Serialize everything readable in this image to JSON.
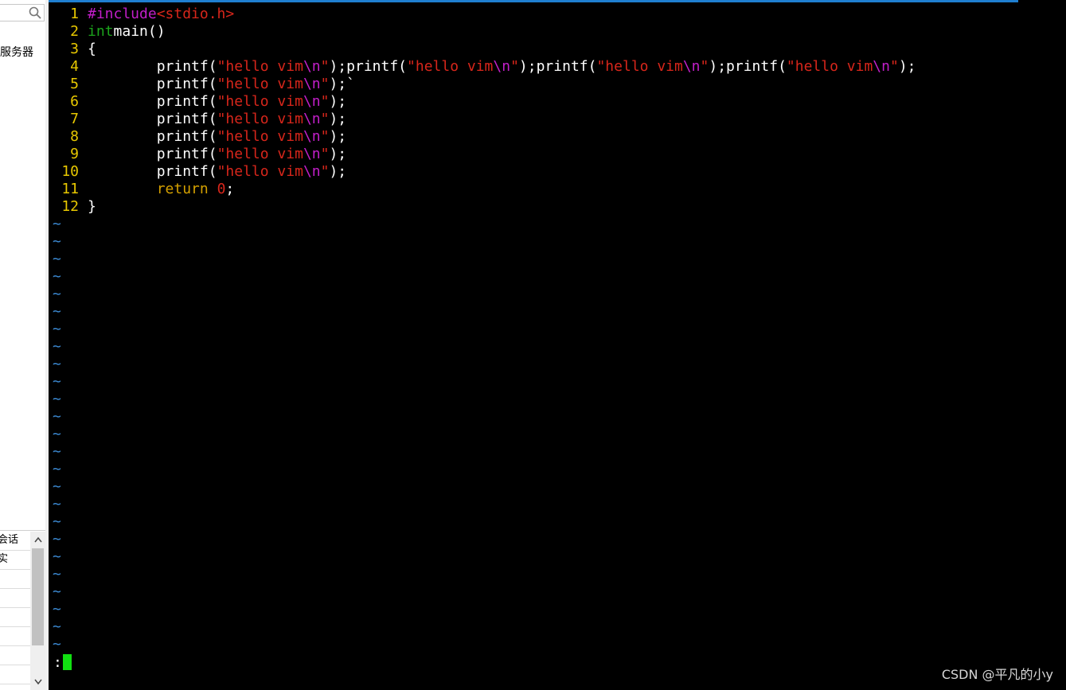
{
  "sidebar": {
    "label": "服务器",
    "list_items": [
      "会话",
      "实",
      "",
      "",
      "",
      "",
      "",
      ""
    ],
    "scroll_up": "^",
    "scroll_down": "v"
  },
  "editor": {
    "lines": [
      {
        "n": "1",
        "tokens": [
          [
            "pp",
            "#include"
          ],
          [
            "str",
            "<stdio.h>"
          ]
        ]
      },
      {
        "n": "2",
        "tokens": [
          [
            "kwg",
            "int"
          ],
          [
            "",
            "main()"
          ]
        ]
      },
      {
        "n": "3",
        "tokens": [
          [
            "",
            "{"
          ]
        ]
      },
      {
        "n": "4",
        "tokens": [
          [
            "",
            "        printf("
          ],
          [
            "str",
            "\"hello vim"
          ],
          [
            "esc",
            "\\n"
          ],
          [
            "str",
            "\""
          ],
          [
            "",
            ");printf("
          ],
          [
            "str",
            "\"hello vim"
          ],
          [
            "esc",
            "\\n"
          ],
          [
            "str",
            "\""
          ],
          [
            "",
            ");printf("
          ],
          [
            "str",
            "\"hello vim"
          ],
          [
            "esc",
            "\\n"
          ],
          [
            "str",
            "\""
          ],
          [
            "",
            ");printf("
          ],
          [
            "str",
            "\"hello vim"
          ],
          [
            "esc",
            "\\n"
          ],
          [
            "str",
            "\""
          ],
          [
            "",
            ");"
          ]
        ]
      },
      {
        "n": "5",
        "tokens": [
          [
            "",
            "        printf("
          ],
          [
            "str",
            "\"hello vim"
          ],
          [
            "esc",
            "\\n"
          ],
          [
            "str",
            "\""
          ],
          [
            "",
            ");`"
          ]
        ]
      },
      {
        "n": "6",
        "tokens": [
          [
            "",
            "        printf("
          ],
          [
            "str",
            "\"hello vim"
          ],
          [
            "esc",
            "\\n"
          ],
          [
            "str",
            "\""
          ],
          [
            "",
            ");"
          ]
        ]
      },
      {
        "n": "7",
        "tokens": [
          [
            "",
            "        printf("
          ],
          [
            "str",
            "\"hello vim"
          ],
          [
            "esc",
            "\\n"
          ],
          [
            "str",
            "\""
          ],
          [
            "",
            ");"
          ]
        ]
      },
      {
        "n": "8",
        "tokens": [
          [
            "",
            "        printf("
          ],
          [
            "str",
            "\"hello vim"
          ],
          [
            "esc",
            "\\n"
          ],
          [
            "str",
            "\""
          ],
          [
            "",
            ");"
          ]
        ]
      },
      {
        "n": "9",
        "tokens": [
          [
            "",
            "        printf("
          ],
          [
            "str",
            "\"hello vim"
          ],
          [
            "esc",
            "\\n"
          ],
          [
            "str",
            "\""
          ],
          [
            "",
            ");"
          ]
        ]
      },
      {
        "n": "10",
        "tokens": [
          [
            "",
            "        printf("
          ],
          [
            "str",
            "\"hello vim"
          ],
          [
            "esc",
            "\\n"
          ],
          [
            "str",
            "\""
          ],
          [
            "",
            ");"
          ]
        ]
      },
      {
        "n": "11",
        "tokens": [
          [
            "kw",
            "        return "
          ],
          [
            "num",
            "0"
          ],
          [
            "",
            ";"
          ]
        ]
      },
      {
        "n": "12",
        "tokens": [
          [
            "",
            "}"
          ]
        ]
      }
    ],
    "tilde_char": "~",
    "tilde_count": 25,
    "command_prompt": ":"
  },
  "watermark": "CSDN @平凡的小y",
  "colors": {
    "line_number": "#e8c800",
    "preprocessor": "#c21fc9",
    "string": "#d8261b",
    "type_keyword": "#1ca31c",
    "tilde": "#3c8bd5",
    "cursor": "#11e011"
  },
  "icons": {
    "search": "search-icon"
  }
}
